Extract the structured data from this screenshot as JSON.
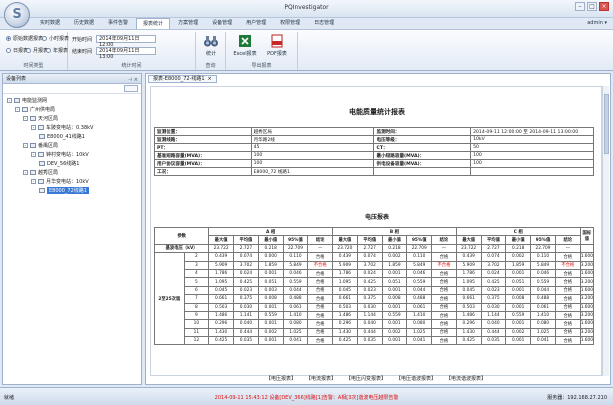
{
  "window": {
    "title": "PQInvestigator",
    "user_label": "admin ▾"
  },
  "tabs": [
    "实时数据",
    "历史数据",
    "事件告警",
    "报表统计",
    "方案管理",
    "设备管理",
    "用户管理",
    "权限管理",
    "日志管理"
  ],
  "active_tab_index": 3,
  "ribbon": {
    "period_group_label": "时间类型",
    "stat_group_label": "统计时间",
    "query_group_label": "查询",
    "export_group_label": "导出报表",
    "radio_labels": [
      "原始数据报表",
      "小时报表",
      "日报表",
      "月报表",
      "年报表"
    ],
    "start_label": "开始时间",
    "end_label": "结束时间",
    "start_value": "2014年09月11日 12:00",
    "end_value": "2014年09月11日 13:00",
    "stat_button": "统计",
    "excel_button": "Excel报表",
    "pdf_button": "PDF报表"
  },
  "left_panel": {
    "title": "设备列表",
    "pin": "⊣ ×",
    "tree": [
      {
        "label": "电能监测网",
        "level": 0,
        "exp": "-"
      },
      {
        "label": "广州供电局",
        "level": 1,
        "exp": "-"
      },
      {
        "label": "天河区局",
        "level": 2,
        "exp": "-"
      },
      {
        "label": "车陂变电站：0.38kV",
        "level": 3,
        "exp": "-"
      },
      {
        "label": "E8000_41线路1",
        "level": 4,
        "exp": ""
      },
      {
        "label": "番禺区局",
        "level": 2,
        "exp": "-"
      },
      {
        "label": "钟村变电站：10kV",
        "level": 3,
        "exp": "-"
      },
      {
        "label": "DEV_56线路1",
        "level": 4,
        "exp": ""
      },
      {
        "label": "越秀区局",
        "level": 2,
        "exp": "-"
      },
      {
        "label": "月华变电站：10kV",
        "level": 3,
        "exp": "-"
      },
      {
        "label": "E8000_72线路1",
        "level": 4,
        "exp": "",
        "selected": true
      }
    ]
  },
  "doc": {
    "tab_label": "报表-E8000_72-线路1",
    "tab_close": "×",
    "report_title": "电能质量统计报表",
    "info_rows": [
      [
        "监测位置：",
        "越秀区局",
        "监测时间：",
        "2014-09-11 12:00:00 至 2014-09-11 13:00:00"
      ],
      [
        "监测线路：",
        "月华路2线",
        "电压等级：",
        "10kV"
      ],
      [
        "PT：",
        "45",
        "CT：",
        "50"
      ],
      [
        "基准短路容量(MVA)：",
        "100",
        "最小短路容量(MVA)：",
        "100"
      ],
      [
        "用户协议容量(MVA)：",
        "100",
        "供电设备容量(MVA)：",
        "100"
      ],
      [
        "工况：",
        "E8000_72 线路1",
        "",
        ""
      ]
    ],
    "voltage_title": "电压报表",
    "phase_a": "A 相",
    "phase_b": "B 相",
    "phase_c": "C 相",
    "param_header": "参数",
    "limit_header": "国标值",
    "sub_headers": [
      "最大值",
      "平均值",
      "最小值",
      "95%值",
      "结论"
    ],
    "base_row_label": "基波电压（kV）",
    "base_row": [
      "23.722",
      "2.727",
      "0.218",
      "22.709",
      "—",
      "23.720",
      "2.727",
      "0.218",
      "22.709",
      "—",
      "23.722",
      "2.727",
      "0.218",
      "22.709",
      "—",
      ""
    ],
    "harm_label": "2至25次谐",
    "rows": [
      {
        "n": "2",
        "v": [
          "0.439",
          "0.074",
          "0.000",
          "0.110",
          "合格",
          "0.439",
          "0.074",
          "0.002",
          "0.110",
          "合格",
          "0.439",
          "0.074",
          "0.002",
          "0.110",
          "合格",
          "1.600"
        ]
      },
      {
        "n": "3",
        "v": [
          "5.909",
          "3.702",
          "1.859",
          "5.849",
          "不合格",
          "5.909",
          "3.702",
          "1.859",
          "5.849",
          "不合格",
          "5.909",
          "3.702",
          "1.859",
          "5.849",
          "不合格",
          "3.200"
        ]
      },
      {
        "n": "4",
        "v": [
          "1.786",
          "0.024",
          "0.001",
          "0.046",
          "合格",
          "1.786",
          "0.024",
          "0.001",
          "0.046",
          "合格",
          "1.786",
          "0.024",
          "0.001",
          "0.046",
          "合格",
          "1.600"
        ]
      },
      {
        "n": "5",
        "v": [
          "1.095",
          "0.425",
          "0.051",
          "0.559",
          "合格",
          "1.095",
          "0.425",
          "0.051",
          "0.559",
          "合格",
          "1.095",
          "0.425",
          "0.051",
          "0.559",
          "合格",
          "3.200"
        ]
      },
      {
        "n": "6",
        "v": [
          "0.045",
          "0.023",
          "0.003",
          "0.044",
          "合格",
          "0.045",
          "0.023",
          "0.001",
          "0.044",
          "合格",
          "0.045",
          "0.023",
          "0.001",
          "0.044",
          "合格",
          "1.600"
        ]
      },
      {
        "n": "7",
        "v": [
          "0.661",
          "0.375",
          "0.008",
          "0.488",
          "合格",
          "0.661",
          "0.375",
          "0.008",
          "0.488",
          "合格",
          "0.661",
          "0.375",
          "0.008",
          "0.488",
          "合格",
          "3.200"
        ]
      },
      {
        "n": "8",
        "v": [
          "0.503",
          "0.030",
          "0.001",
          "0.061",
          "合格",
          "0.503",
          "0.030",
          "0.001",
          "0.061",
          "合格",
          "0.503",
          "0.030",
          "0.001",
          "0.061",
          "合格",
          "1.600"
        ]
      },
      {
        "n": "9",
        "v": [
          "1.486",
          "1.141",
          "0.559",
          "1.410",
          "合格",
          "1.486",
          "1.144",
          "0.559",
          "1.410",
          "合格",
          "1.486",
          "1.144",
          "0.559",
          "1.410",
          "合格",
          "3.200"
        ]
      },
      {
        "n": "10",
        "v": [
          "0.296",
          "0.040",
          "0.001",
          "0.080",
          "合格",
          "0.296",
          "0.040",
          "0.001",
          "0.080",
          "合格",
          "0.296",
          "0.040",
          "0.001",
          "0.080",
          "合格",
          "1.600"
        ]
      },
      {
        "n": "11",
        "v": [
          "1.430",
          "0.444",
          "0.002",
          "1.025",
          "合格",
          "1.430",
          "0.444",
          "0.002",
          "1.025",
          "合格",
          "1.430",
          "0.444",
          "0.002",
          "1.025",
          "合格",
          "3.200"
        ]
      },
      {
        "n": "12",
        "v": [
          "0.425",
          "0.035",
          "0.001",
          "0.041",
          "合格",
          "0.425",
          "0.035",
          "0.001",
          "0.041",
          "合格",
          "0.425",
          "0.035",
          "0.001",
          "0.041",
          "合格",
          "1.600"
        ]
      }
    ],
    "bottom_links": [
      "【电压报表】",
      "【电流报表】",
      "【电压闪变报表】",
      "【电压谐波报表】",
      "【电流谐波报表】"
    ]
  },
  "status": {
    "left": "就绪",
    "middle": "2014-09-11 15:43:12 设备[DEV_366]线路[1]告警：A相[3次]谐波电压越限告警",
    "right": "服务器：192.168.27.210"
  }
}
